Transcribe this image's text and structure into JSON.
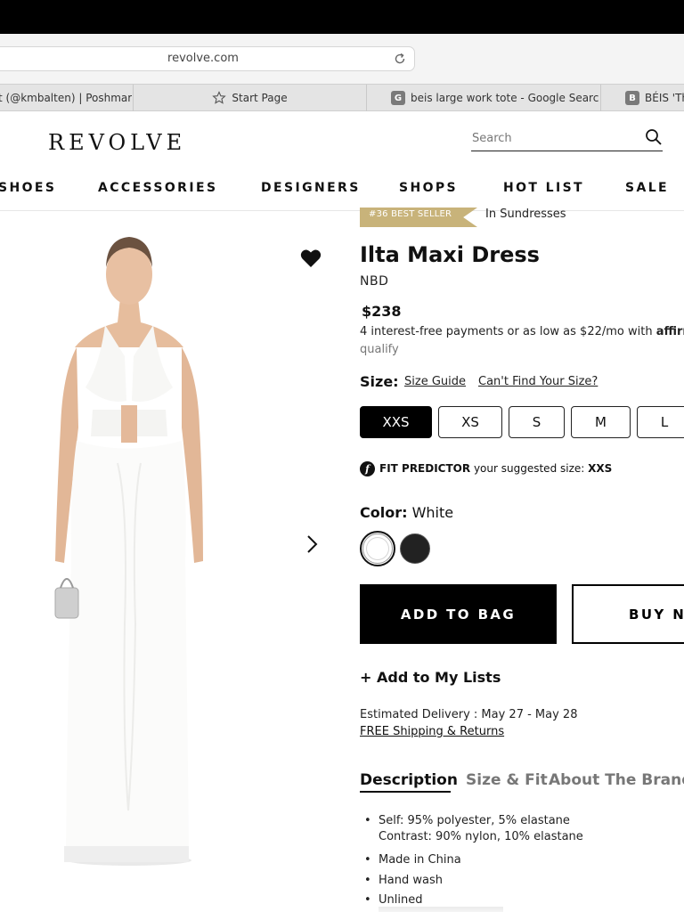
{
  "browser": {
    "url": "revolve.com",
    "tabs": [
      {
        "label": "t (@kmbalten) | Poshmark",
        "icon": "none"
      },
      {
        "label": "Start Page",
        "icon": "star-icon"
      },
      {
        "label": "beis large work tote - Google Search",
        "icon": "G"
      },
      {
        "label": "BÉIS 'Th",
        "icon": "B"
      }
    ]
  },
  "header": {
    "logo": "REVOLVE",
    "search_placeholder": "Search"
  },
  "nav": {
    "items": [
      "SHOES",
      "ACCESSORIES",
      "DESIGNERS",
      "SHOPS",
      "HOT LIST",
      "SALE"
    ]
  },
  "product": {
    "badge": "#36 BEST SELLER",
    "badge_category": "In Sundresses",
    "title": "Ilta Maxi Dress",
    "brand": "NBD",
    "price": "$238",
    "payment_line1": "4 interest-free payments or as low as $22/mo with",
    "payment_brand": "affirm",
    "payment_line2": "qualify",
    "size_label": "Size:",
    "size_guide": "Size Guide",
    "cant_find": "Can't Find Your Size?",
    "sizes": [
      "XXS",
      "XS",
      "S",
      "M",
      "L"
    ],
    "selected_size": "XXS",
    "fit_icon": "f",
    "fit_predictor": "FIT PREDICTOR",
    "fit_text": "your suggested size:",
    "fit_size": "XXS",
    "color_label": "Color:",
    "color_value": "White",
    "colors": {
      "white": "#ffffff",
      "black": "#222222"
    },
    "add_to_bag": "ADD TO BAG",
    "buy_now": "BUY NOW",
    "add_lists": "+ Add to My Lists",
    "delivery": "Estimated Delivery : May 27 - May 28",
    "shipping": "FREE Shipping & Returns",
    "tabs": [
      "Description",
      "Size & Fit",
      "About The Brand"
    ],
    "description": [
      "Self: 95% polyester, 5% elastane",
      "Contrast: 90% nylon, 10% elastane",
      "Made in China",
      "Hand wash",
      "Unlined"
    ]
  },
  "colors": {
    "badge": "#c8b37a",
    "primary": "#000000"
  }
}
